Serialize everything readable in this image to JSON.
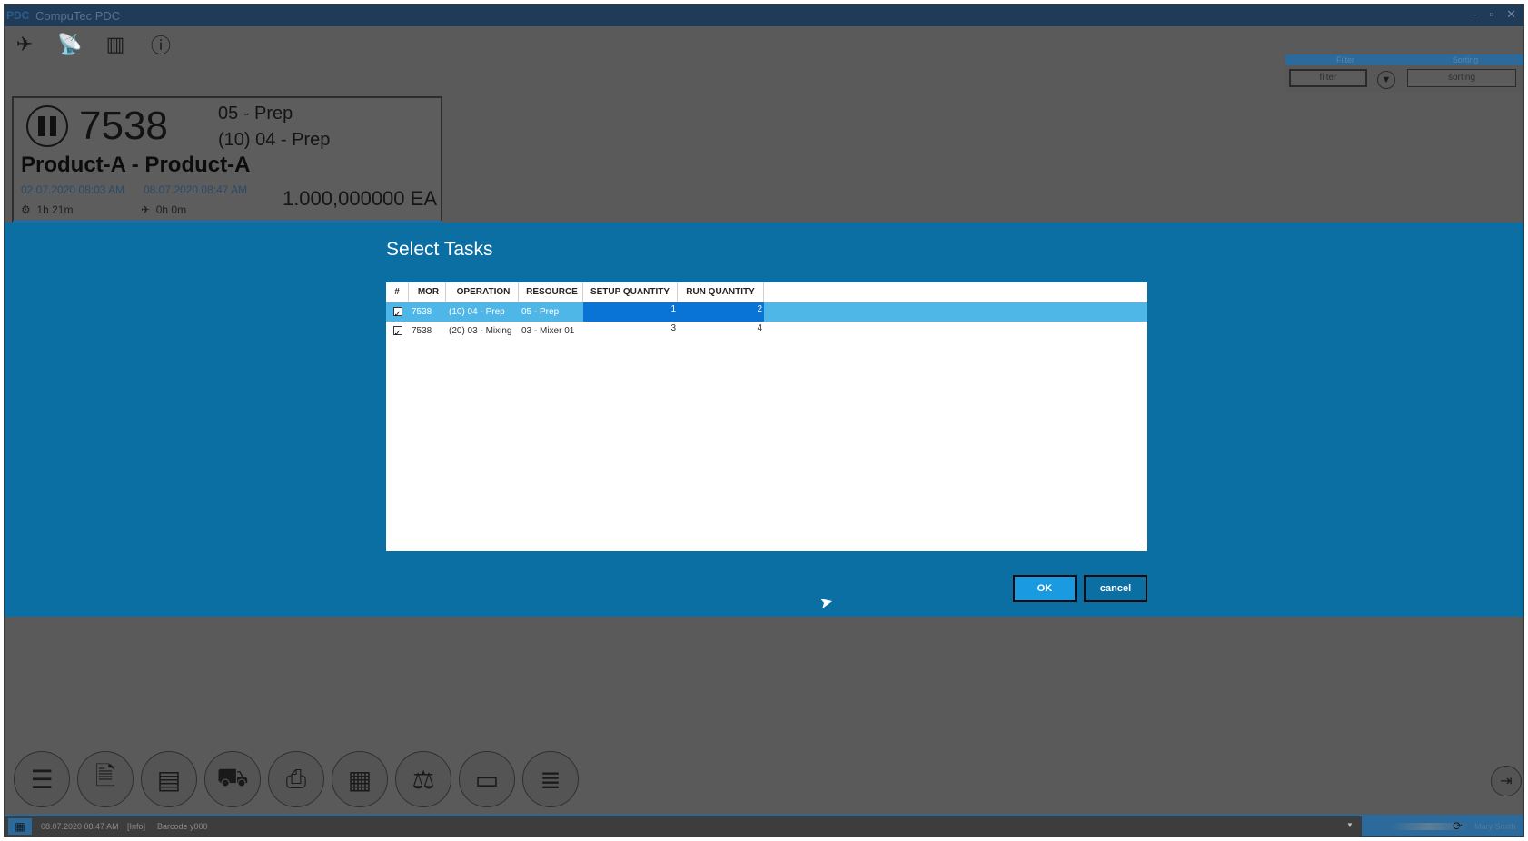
{
  "window": {
    "logo": "PDC",
    "title": "CompuTec PDC",
    "buttons": [
      "–",
      "▫",
      "✕"
    ]
  },
  "top_icons": [
    "plane-icon",
    "signal-icon",
    "barcode-icon",
    "info-icon"
  ],
  "filter": {
    "filter_header": "Filter",
    "sorting_header": "Sorting",
    "filter_button": "filter",
    "sorting_button": "sorting"
  },
  "card": {
    "number": "7538",
    "resource": "05 - Prep",
    "operation": "(10) 04 - Prep",
    "product": "Product-A - Product-A",
    "start": "02.07.2020 08:03 AM",
    "end": "08.07.2020 08:47 AM",
    "setup_time": "1h 21m",
    "run_time": "0h 0m",
    "quantity": "1.000,000000 EA"
  },
  "dialog": {
    "title": "Select Tasks",
    "columns": [
      "#",
      "MOR",
      "OPERATION",
      "RESOURCE",
      "SETUP QUANTITY",
      "RUN QUANTITY"
    ],
    "rows": [
      {
        "mor": "7538",
        "operation": "(10) 04 - Prep",
        "resource": "05 - Prep",
        "setup": "1",
        "run": "2",
        "checked": true,
        "selected": true
      },
      {
        "mor": "7538",
        "operation": "(20) 03 - Mixing",
        "resource": "03 - Mixer 01",
        "setup": "3",
        "run": "4",
        "checked": true,
        "selected": false
      }
    ],
    "ok_label": "OK",
    "cancel_label": "cancel"
  },
  "bottom_icons": [
    "task-list-icon",
    "document-add-icon",
    "board-icon",
    "forklift-icon",
    "printer-icon",
    "list-add-icon",
    "scale-icon",
    "drawer-icon",
    "list-settings-icon"
  ],
  "status": {
    "time": "08.07.2020 08:47 AM",
    "level": "[Info]",
    "message": "Barcode y000",
    "user": "Mary Smith"
  }
}
